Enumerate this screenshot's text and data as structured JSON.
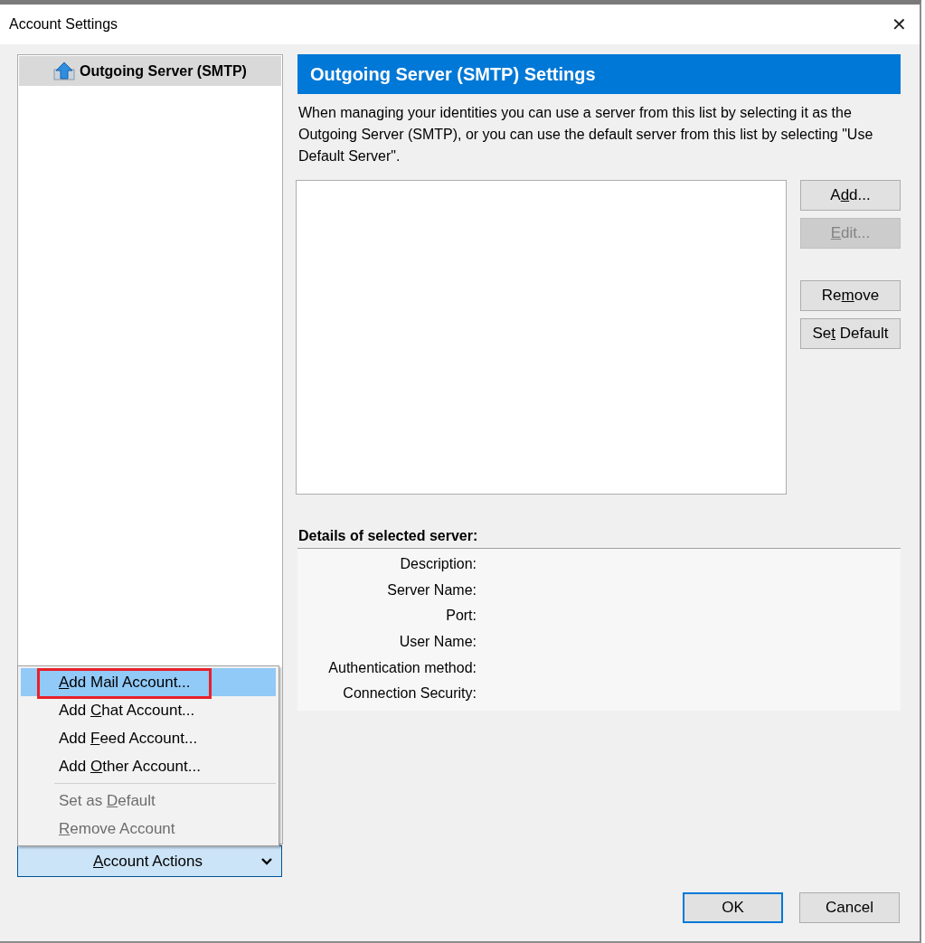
{
  "window": {
    "title": "Account Settings",
    "close": "✕"
  },
  "sidebar": {
    "items": [
      {
        "label": "Outgoing Server (SMTP)",
        "selected": true
      }
    ]
  },
  "panel": {
    "heading": "Outgoing Server (SMTP) Settings",
    "description": "When managing your identities you can use a server from this list by selecting it as the Outgoing Server (SMTP), or you can use the default server from this list by selecting \"Use Default Server\".",
    "buttons": [
      {
        "pre": "A",
        "key": "d",
        "post": "d...",
        "disabled": false
      },
      {
        "key": "E",
        "post": "dit...",
        "disabled": true
      },
      {
        "pre": "Re",
        "key": "m",
        "post": "ove",
        "disabled": false
      },
      {
        "pre": "Se",
        "key": "t",
        "post": " Default",
        "disabled": false
      }
    ],
    "details_heading": "Details of selected server:",
    "details": [
      "Description:",
      "Server Name:",
      "Port:",
      "User Name:",
      "Authentication method:",
      "Connection Security:"
    ]
  },
  "menu": {
    "items": [
      {
        "kind": "item",
        "key": "A",
        "post": "dd Mail Account...",
        "selected": true,
        "disabled": false,
        "annotated": true
      },
      {
        "kind": "item",
        "pre": "Add ",
        "key": "C",
        "post": "hat Account...",
        "selected": false,
        "disabled": false,
        "annotated": false
      },
      {
        "kind": "item",
        "pre": "Add ",
        "key": "F",
        "post": "eed Account...",
        "selected": false,
        "disabled": false,
        "annotated": false
      },
      {
        "kind": "item",
        "pre": "Add ",
        "key": "O",
        "post": "ther Account...",
        "selected": false,
        "disabled": false,
        "annotated": false
      },
      {
        "kind": "separator"
      },
      {
        "kind": "item",
        "pre": "Set as ",
        "key": "D",
        "post": "efault",
        "selected": false,
        "disabled": true,
        "annotated": false
      },
      {
        "kind": "item",
        "key": "R",
        "post": "emove Account",
        "selected": false,
        "disabled": true,
        "annotated": false
      }
    ]
  },
  "account_actions": {
    "key": "A",
    "post": "ccount Actions"
  },
  "footer": {
    "buttons": [
      {
        "label": "OK",
        "default": true
      },
      {
        "label": "Cancel",
        "default": false
      }
    ]
  }
}
